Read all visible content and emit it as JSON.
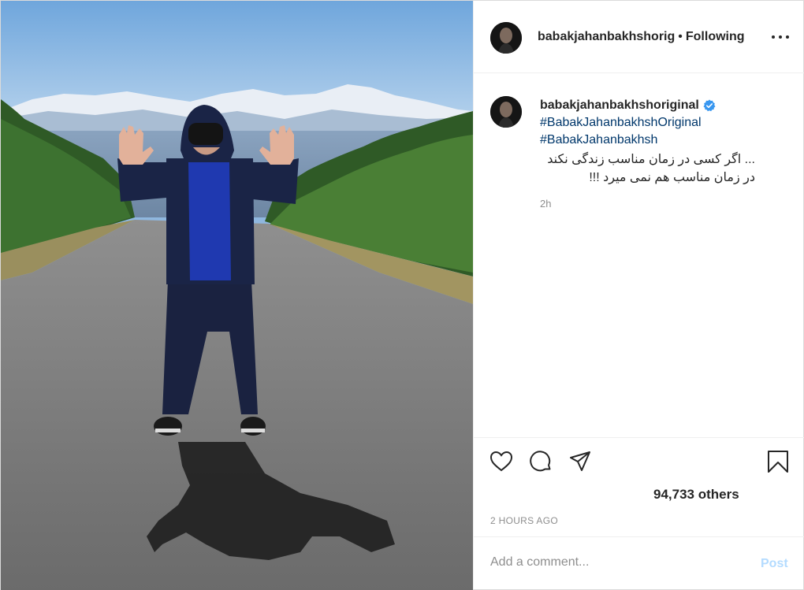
{
  "header": {
    "username": "babakjahanbakhshorig",
    "separator": "•",
    "follow_status": "Following",
    "more_icon": "more-horizontal-icon"
  },
  "caption": {
    "username": "babakjahanbakhshoriginal",
    "verified_icon": "verified-badge-icon",
    "hashtags": [
      "#BabakJahanbakhshOriginal",
      "#BabakJahanbakhsh"
    ],
    "lines": [
      "... اگر کسی در زمان مناسب زندگی نکند",
      "در زمان مناسب هم نمی میرد !!!"
    ],
    "age": "2h"
  },
  "actions": {
    "icons": [
      "heart-icon",
      "comment-icon",
      "share-icon",
      "bookmark-icon"
    ],
    "likes_text": "94,733 others",
    "timestamp": "2 HOURS AGO"
  },
  "comment": {
    "placeholder": "Add a comment...",
    "post_label": "Post"
  },
  "colors": {
    "hashtag": "#00376b",
    "verified": "#3897f0",
    "post_button_disabled": "#b3dbff",
    "secondary_text": "#8e8e8e"
  }
}
